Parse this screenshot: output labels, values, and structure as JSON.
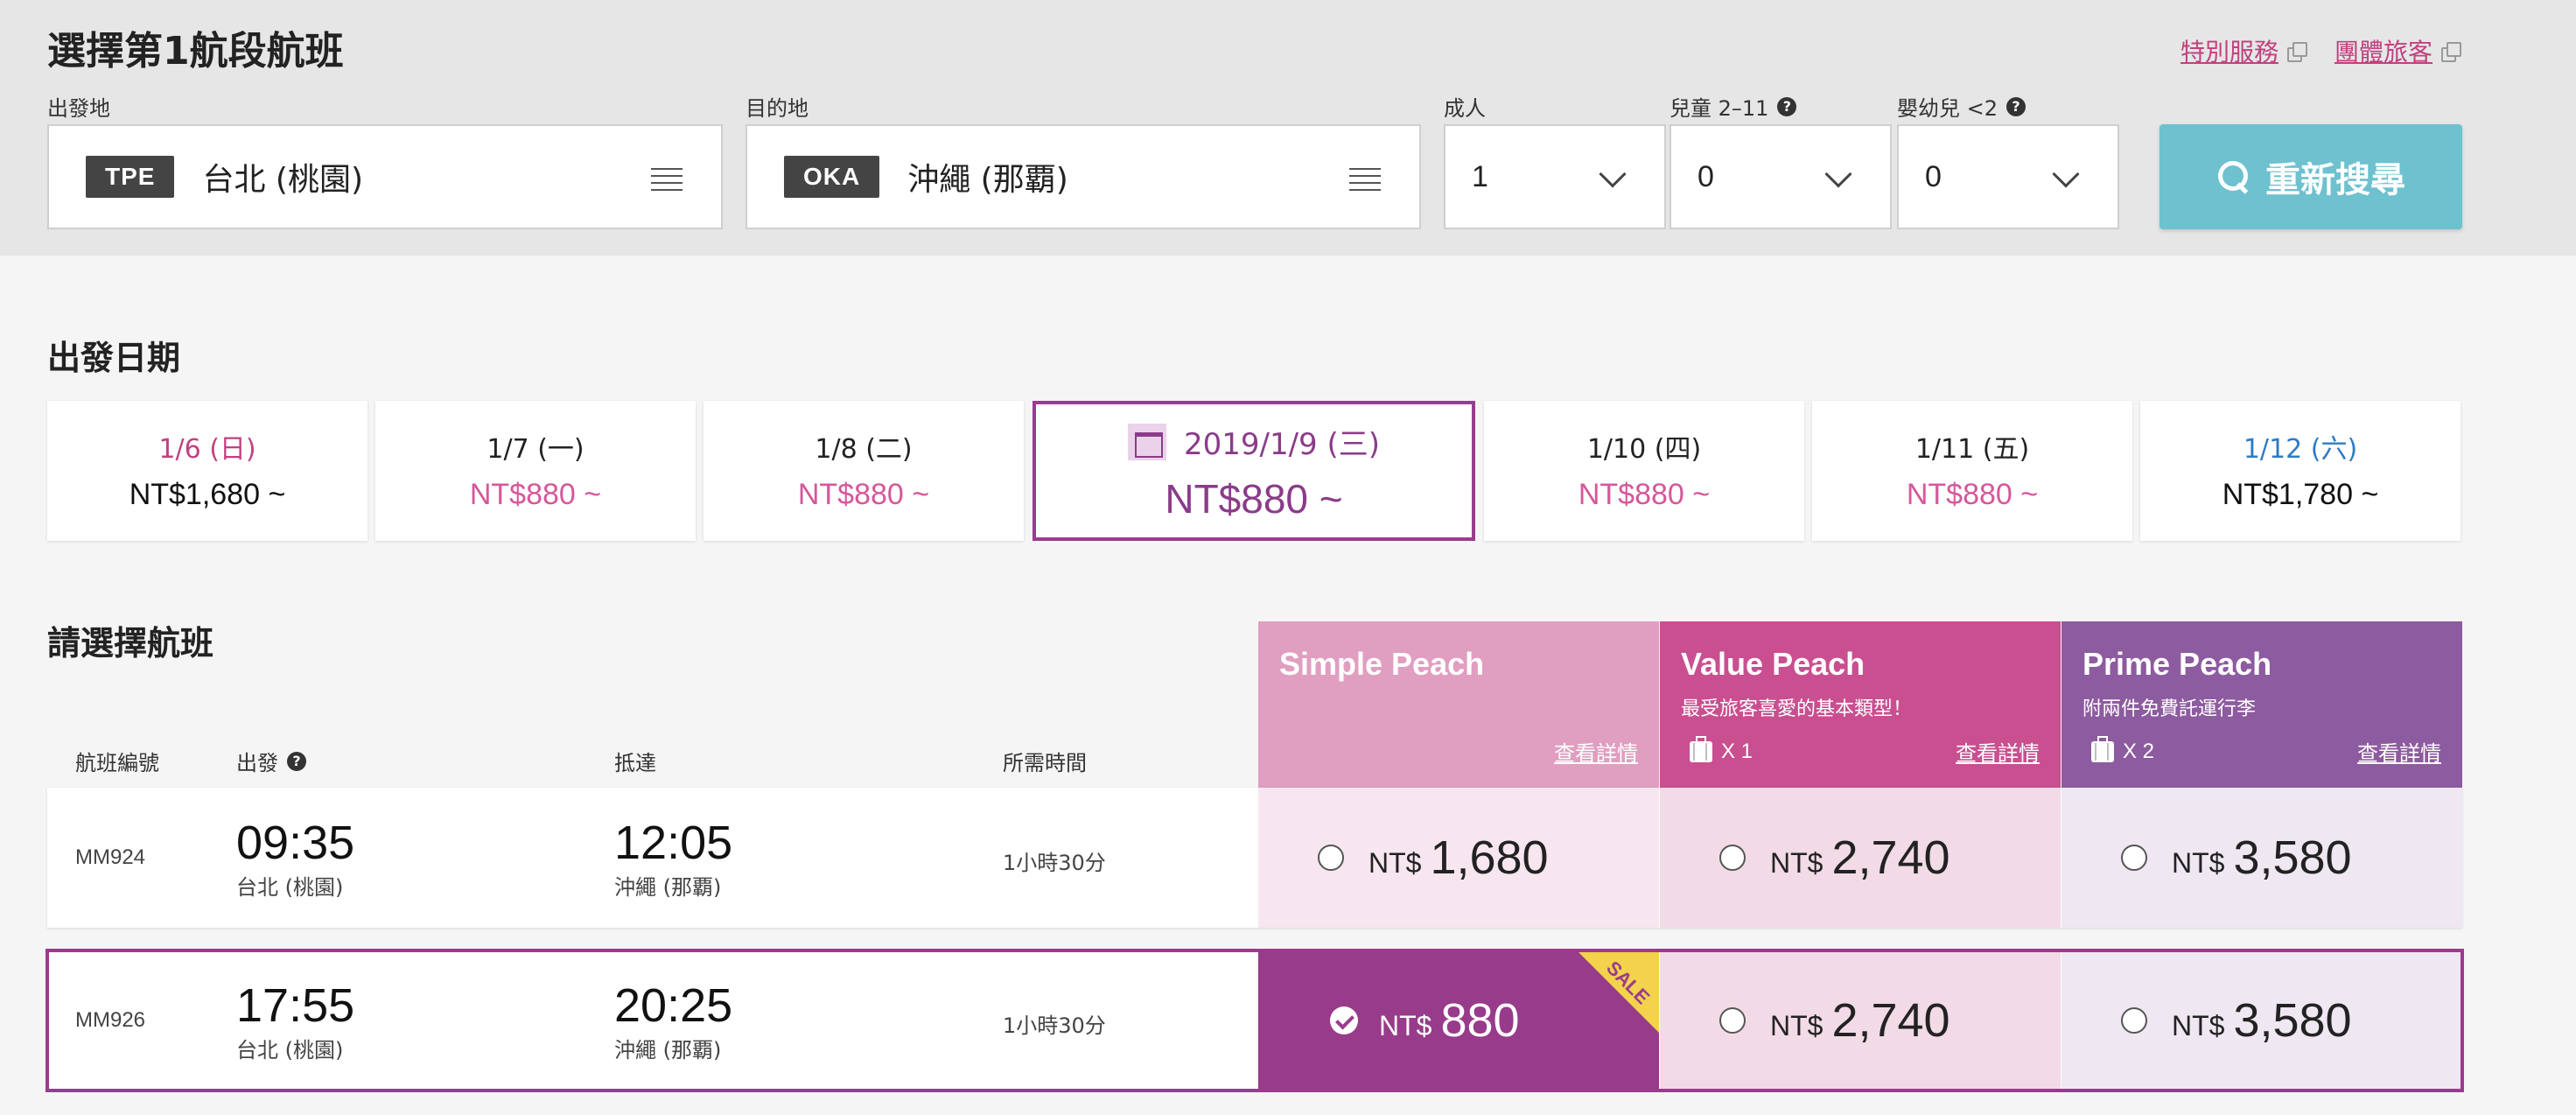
{
  "header": {
    "title": "選擇第1航段航班",
    "links": [
      {
        "label": "特別服務"
      },
      {
        "label": "團體旅客"
      }
    ]
  },
  "search": {
    "origin_label": "出發地",
    "origin_code": "TPE",
    "origin_name": "台北 (桃園)",
    "destination_label": "目的地",
    "destination_code": "OKA",
    "destination_name": "沖繩 (那覇)",
    "adults_label": "成人",
    "adults_value": "1",
    "children_label": "兒童 2–11",
    "children_value": "0",
    "infants_label": "嬰幼兒 <2",
    "infants_value": "0",
    "search_button": "重新搜尋"
  },
  "dates": {
    "title": "出發日期",
    "items": [
      {
        "label": "1/6 (日)",
        "price": "NT$1,680 ~"
      },
      {
        "label": "1/7 (一)",
        "price": "NT$880 ~"
      },
      {
        "label": "1/8 (二)",
        "price": "NT$880 ~"
      },
      {
        "label": "2019/1/9 (三)",
        "price": "NT$880 ~",
        "selected": true
      },
      {
        "label": "1/10 (四)",
        "price": "NT$880 ~"
      },
      {
        "label": "1/11 (五)",
        "price": "NT$880 ~"
      },
      {
        "label": "1/12 (六)",
        "price": "NT$1,780 ~"
      }
    ]
  },
  "flights": {
    "title": "請選擇航班",
    "columns": {
      "flight_no": "航班編號",
      "depart": "出發",
      "arrive": "抵達",
      "duration": "所需時間"
    },
    "fares": [
      {
        "name": "Simple Peach",
        "subtitle": "",
        "baggage": "",
        "detail": "查看詳情",
        "color": "#e09ec0"
      },
      {
        "name": "Value Peach",
        "subtitle": "最受旅客喜愛的基本類型！",
        "baggage": "X 1",
        "detail": "查看詳情",
        "color": "#c94f90"
      },
      {
        "name": "Prime Peach",
        "subtitle": "附兩件免費託運行李",
        "baggage": "X 2",
        "detail": "查看詳情",
        "color": "#8d5b9f"
      }
    ],
    "currency": "NT$",
    "rows": [
      {
        "flight_no": "MM924",
        "depart_time": "09:35",
        "depart_city": "台北 (桃園)",
        "arrive_time": "12:05",
        "arrive_city": "沖繩 (那覇)",
        "duration": "1小時30分",
        "prices": [
          "1,680",
          "2,740",
          "3,580"
        ]
      },
      {
        "flight_no": "MM926",
        "depart_time": "17:55",
        "depart_city": "台北 (桃園)",
        "arrive_time": "20:25",
        "arrive_city": "沖繩 (那覇)",
        "duration": "1小時30分",
        "prices": [
          "880",
          "2,740",
          "3,580"
        ],
        "sale_tag": "SALE"
      }
    ]
  },
  "colors": {
    "accent_purple": "#9b3b8e",
    "search_button": "#6ec1cf",
    "link_pink": "#c1417f",
    "sunday": "#c1417f",
    "saturday": "#2e7bc4"
  }
}
